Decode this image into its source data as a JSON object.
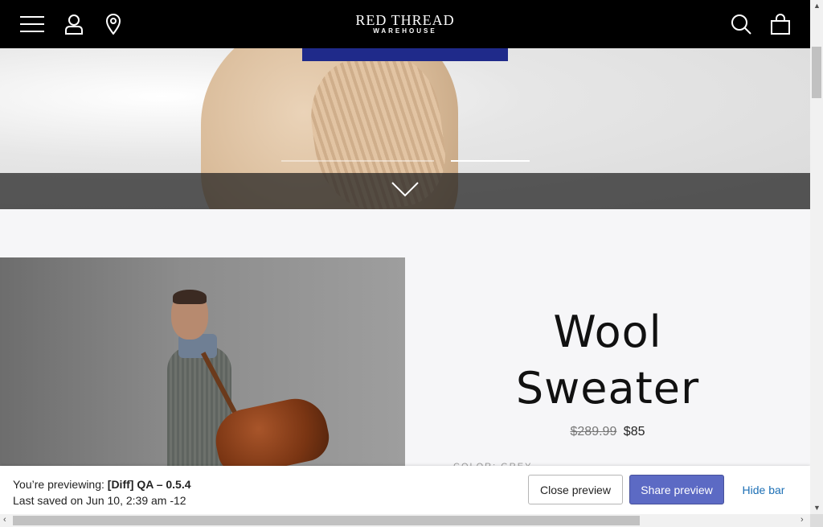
{
  "header": {
    "logo_line1": "RED THREAD",
    "logo_line2": "WAREHOUSE",
    "icons": [
      "menu-icon",
      "account-icon",
      "location-icon",
      "search-icon",
      "bag-icon"
    ]
  },
  "hero": {
    "accent_color": "#1f2a8a"
  },
  "product": {
    "title_line1": "Wool",
    "title_line2": "Sweater",
    "price_original": "$289.99",
    "price_sale": "$85",
    "color_label": "COLOR: GREY"
  },
  "preview_bar": {
    "prefix": "You’re previewing: ",
    "theme_name": "[Diff] QA – 0.5.4",
    "last_saved": "Last saved on Jun 10, 2:39 am -12",
    "close_label": "Close preview",
    "share_label": "Share preview",
    "hide_label": "Hide bar",
    "share_color": "#5c6ac4"
  }
}
